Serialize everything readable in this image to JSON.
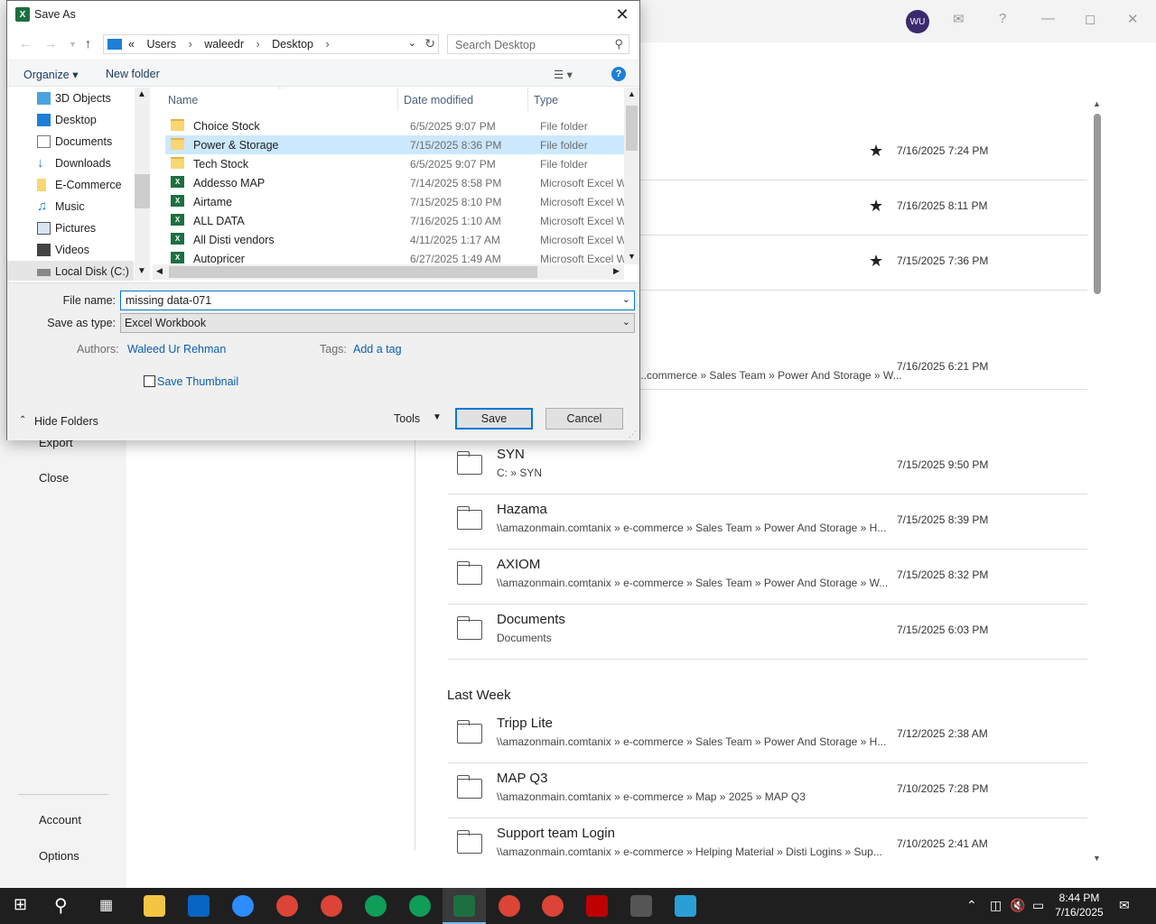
{
  "backstage": {
    "nav_export": "Export",
    "nav_close": "Close",
    "nav_account": "Account",
    "nav_options": "Options",
    "user_initials": "WU",
    "pinned_dates": [
      "7/16/2025 7:24 PM",
      "7/16/2025 8:11 PM",
      "7/15/2025 7:36 PM"
    ],
    "partial_row": {
      "path": "...commerce » Sales Team » Power And Storage » W...",
      "date": "7/16/2025 6:21 PM"
    },
    "recent": [
      {
        "name": "SYN",
        "path": "C: » SYN",
        "date": "7/15/2025 9:50 PM"
      },
      {
        "name": "Hazama",
        "path": "\\\\amazonmain.comtanix » e-commerce » Sales Team » Power And Storage » H...",
        "date": "7/15/2025 8:39 PM"
      },
      {
        "name": "AXIOM",
        "path": "\\\\amazonmain.comtanix » e-commerce » Sales Team » Power And Storage » W...",
        "date": "7/15/2025 8:32 PM"
      },
      {
        "name": "Documents",
        "path": "Documents",
        "date": "7/15/2025 6:03 PM"
      }
    ],
    "last_week_title": "Last Week",
    "last_week": [
      {
        "name": "Tripp Lite",
        "path": "\\\\amazonmain.comtanix » e-commerce » Sales Team » Power And Storage » H...",
        "date": "7/12/2025 2:38 AM"
      },
      {
        "name": "MAP Q3",
        "path": "\\\\amazonmain.comtanix » e-commerce » Map » 2025 » MAP Q3",
        "date": "7/10/2025 7:28 PM"
      },
      {
        "name": "Support team Login",
        "path": "\\\\amazonmain.comtanix » e-commerce » Helping Material » Disti Logins » Sup...",
        "date": "7/10/2025 2:41 AM"
      }
    ]
  },
  "dialog": {
    "title": "Save As",
    "breadcrumb": [
      "«",
      "Users",
      "›",
      "waleedr",
      "›",
      "Desktop",
      "›"
    ],
    "search_placeholder": "Search Desktop",
    "organize_label": "Organize ▾",
    "new_folder_label": "New folder",
    "tree": [
      {
        "label": "3D Objects",
        "icon": "3d-objects-icon"
      },
      {
        "label": "Desktop",
        "icon": "desktop-icon"
      },
      {
        "label": "Documents",
        "icon": "documents-icon"
      },
      {
        "label": "Downloads",
        "icon": "downloads-icon"
      },
      {
        "label": "E-Commerce",
        "icon": "folder-icon"
      },
      {
        "label": "Music",
        "icon": "music-icon"
      },
      {
        "label": "Pictures",
        "icon": "pictures-icon"
      },
      {
        "label": "Videos",
        "icon": "videos-icon"
      },
      {
        "label": "Local Disk (C:)",
        "icon": "drive-icon"
      }
    ],
    "columns": {
      "name": "Name",
      "date": "Date modified",
      "type": "Type"
    },
    "files": [
      {
        "name": "Choice Stock",
        "date": "6/5/2025 9:07 PM",
        "type": "File folder",
        "kind": "folder"
      },
      {
        "name": "Power & Storage",
        "date": "7/15/2025 8:36 PM",
        "type": "File folder",
        "kind": "folder"
      },
      {
        "name": "Tech Stock",
        "date": "6/5/2025 9:07 PM",
        "type": "File folder",
        "kind": "folder"
      },
      {
        "name": "Addesso MAP",
        "date": "7/14/2025 8:58 PM",
        "type": "Microsoft Excel W...",
        "kind": "xl"
      },
      {
        "name": "Airtame",
        "date": "7/15/2025 8:10 PM",
        "type": "Microsoft Excel W...",
        "kind": "xl"
      },
      {
        "name": "ALL DATA",
        "date": "7/16/2025 1:10 AM",
        "type": "Microsoft Excel W...",
        "kind": "xl"
      },
      {
        "name": "All Disti vendors",
        "date": "4/11/2025 1:17 AM",
        "type": "Microsoft Excel W...",
        "kind": "xl"
      },
      {
        "name": "Autopricer",
        "date": "6/27/2025 1:49 AM",
        "type": "Microsoft Excel W...",
        "kind": "xl"
      }
    ],
    "file_name_label": "File name:",
    "file_name_value": "missing data-071",
    "save_type_label": "Save as type:",
    "save_type_value": "Excel Workbook",
    "authors_label": "Authors:",
    "authors_value": "Waleed Ur Rehman",
    "tags_label": "Tags:",
    "tags_value": "Add a tag",
    "thumbnail_label": "Save Thumbnail",
    "hide_folders_label": "Hide Folders",
    "tools_label": "Tools",
    "save_label": "Save",
    "cancel_label": "Cancel"
  },
  "taskbar": {
    "time": "8:44 PM",
    "date": "7/16/2025"
  }
}
